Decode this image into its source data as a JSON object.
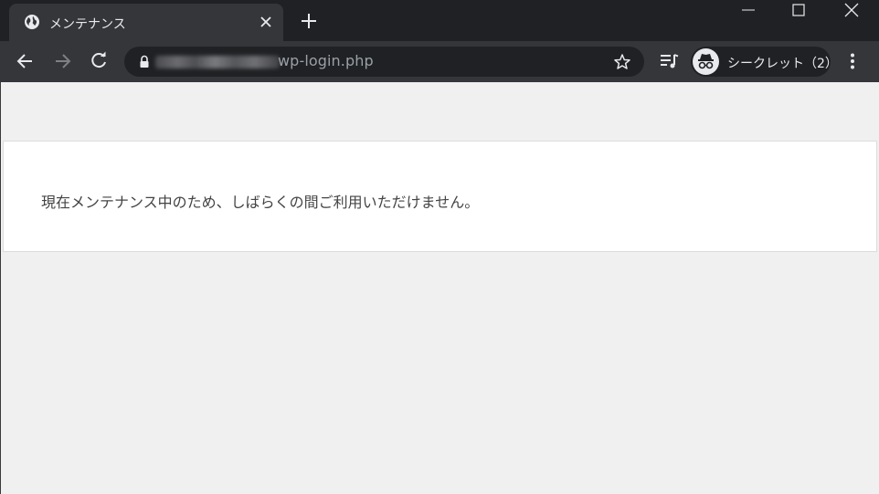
{
  "tab": {
    "title": "メンテナンス",
    "favicon": "globe-icon"
  },
  "window_controls": {
    "minimize": "minimize-icon",
    "maximize": "maximize-icon",
    "close": "close-icon"
  },
  "toolbar": {
    "url_visible": "wp-login.php",
    "url_obscured": true,
    "incognito_label": "シークレット（2）"
  },
  "page": {
    "message": "現在メンテナンス中のため、しばらくの間ご利用いただけません。"
  },
  "colors": {
    "titlebar_bg": "#202124",
    "toolbar_bg": "#35363a",
    "page_bg": "#f0f0f0",
    "card_bg": "#ffffff",
    "text": "#444444"
  }
}
